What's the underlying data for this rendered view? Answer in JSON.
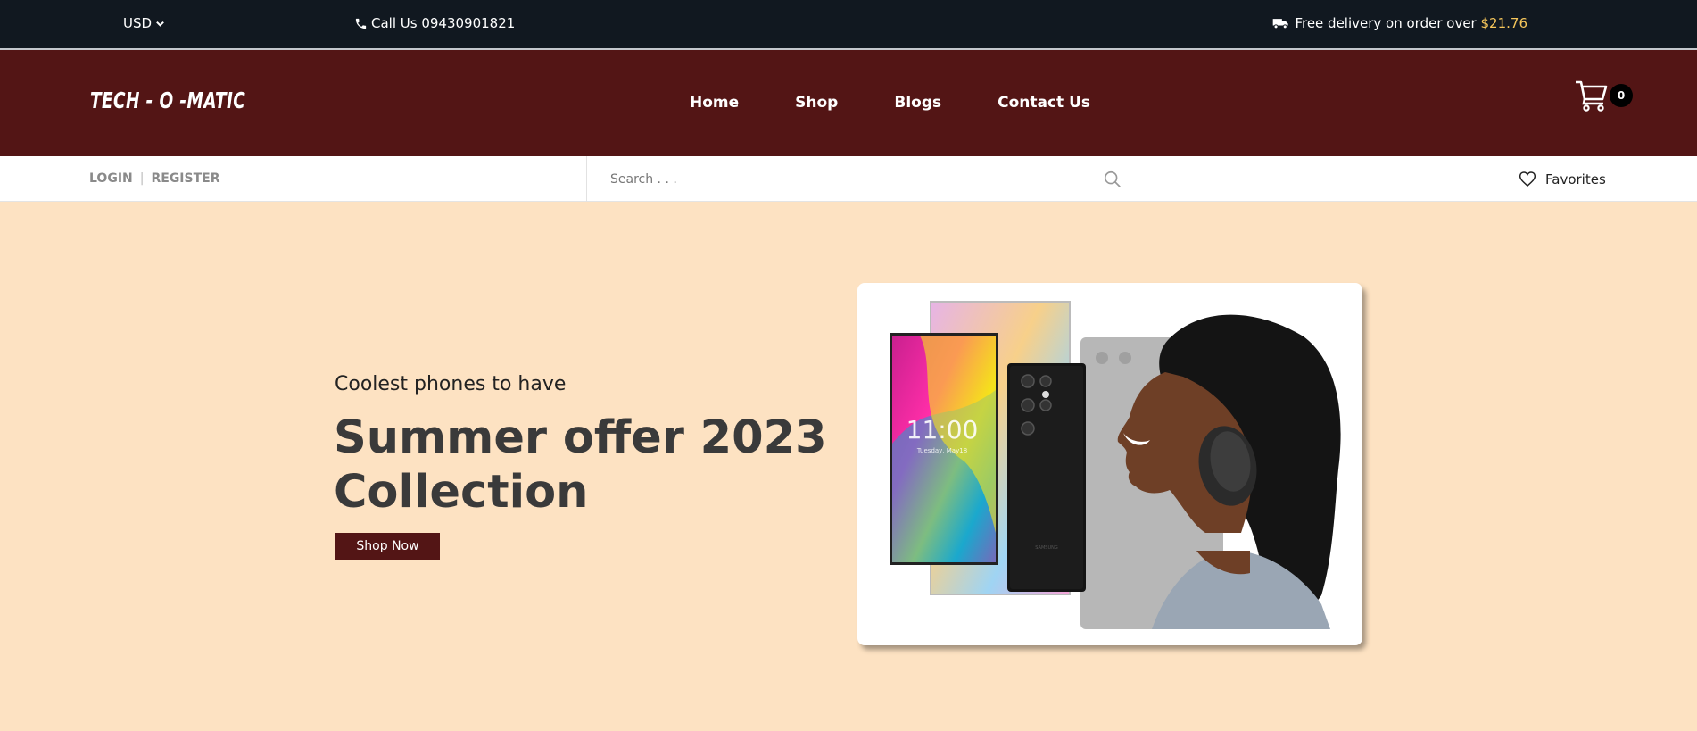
{
  "topbar": {
    "currency": "USD",
    "phone_text": "Call Us 09430901821",
    "delivery_text": "Free delivery on order over ",
    "delivery_price": "$21.76"
  },
  "header": {
    "logo": "TECH - O -MATIC",
    "nav": [
      "Home",
      "Shop",
      "Blogs",
      "Contact Us"
    ],
    "cart_count": "0"
  },
  "subbar": {
    "login": "LOGIN",
    "separator": "|",
    "register": "REGISTER",
    "search_placeholder": "Search . . .",
    "favorites": "Favorites"
  },
  "hero": {
    "subtitle": "Coolest phones to have",
    "title": "Summer offer 2023 Collection",
    "button": "Shop Now",
    "phone_time": "11:00",
    "phone_date": "Tuesday, May18",
    "phone_brand": "SAMSUNG"
  },
  "colors": {
    "topbar_bg": "#111820",
    "header_bg": "#531515",
    "hero_bg": "#fde2c2",
    "price_accent": "#f6c65b"
  }
}
